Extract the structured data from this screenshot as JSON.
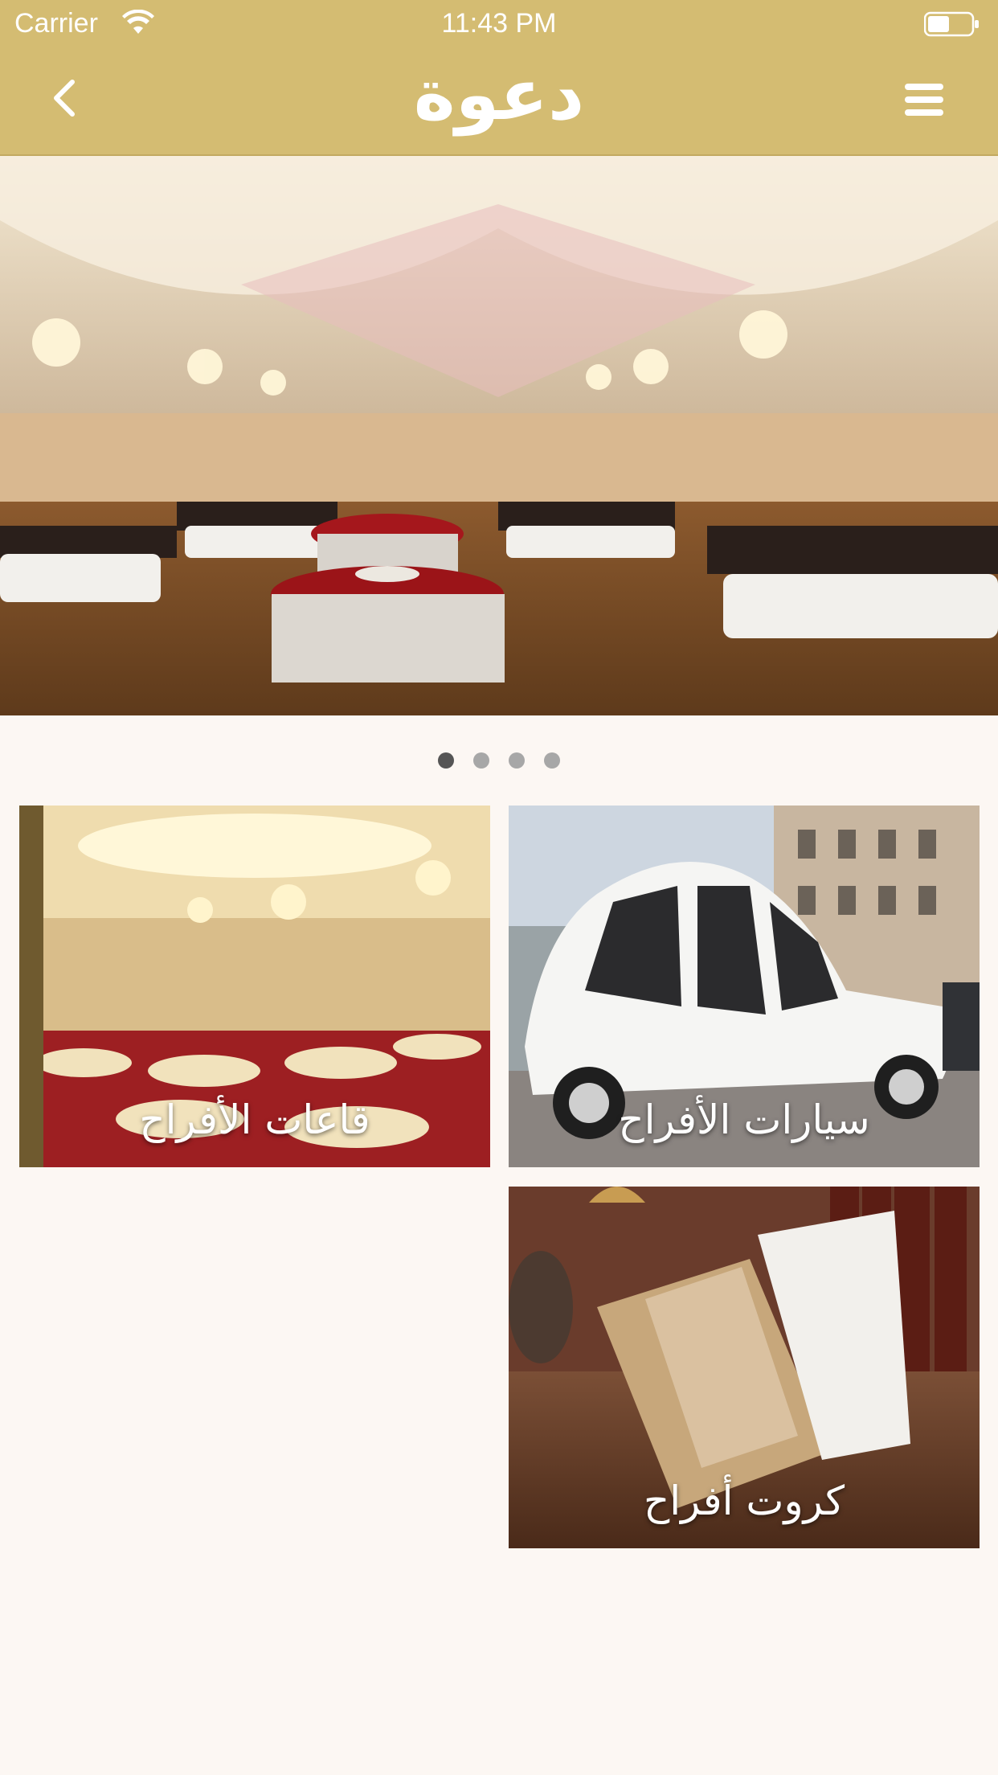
{
  "status_bar": {
    "carrier": "Carrier",
    "time": "11:43 PM",
    "icons": [
      "wifi-icon",
      "battery-icon"
    ]
  },
  "header": {
    "logo_text": "دعوة",
    "icons": [
      "chevron-left-icon",
      "hamburger-menu-icon"
    ]
  },
  "carousel": {
    "slide_count": 4,
    "active_index": 0
  },
  "categories": [
    {
      "label": "قاعات الأفراح"
    },
    {
      "label": "سيارات الأفراح"
    },
    {
      "label": "كروت أفراح"
    }
  ],
  "colors": {
    "header": "#d4bc72",
    "background": "#fcf7f3",
    "dot_active": "#555555",
    "dot_inactive": "#a7a7a7"
  }
}
